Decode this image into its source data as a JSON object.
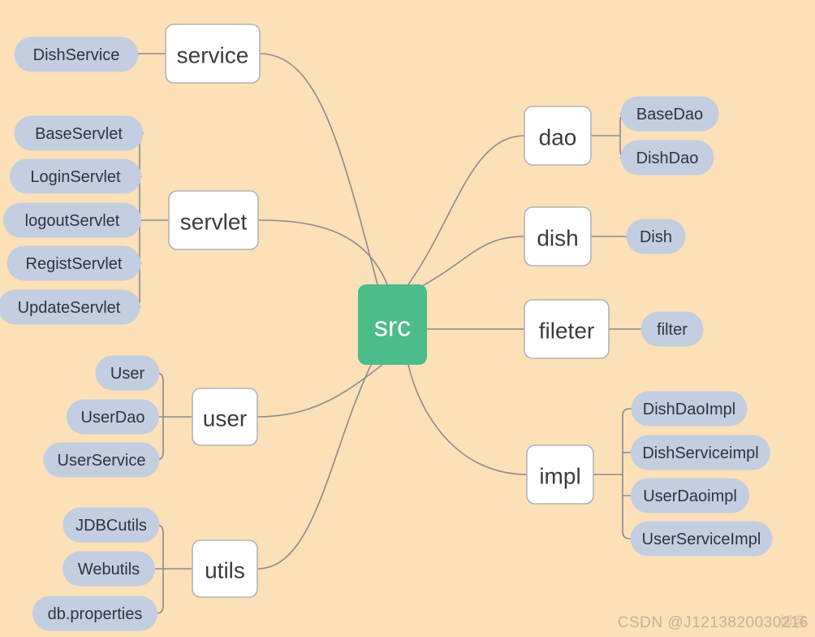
{
  "diagram": {
    "title": "src",
    "type": "mind-map",
    "background_color": "#fce0b8",
    "root": {
      "label": "src",
      "color": "#4cbc8b",
      "text_color": "#ffffff"
    },
    "branch_color": "#ffffff",
    "leaf_color": "#c3cee0",
    "link_color": "#8c8c8c",
    "branches": [
      {
        "label": "service",
        "side": "left",
        "leaves": [
          "DishService"
        ]
      },
      {
        "label": "servlet",
        "side": "left",
        "leaves": [
          "BaseServlet",
          "LoginServlet",
          "logoutServlet",
          "RegistServlet",
          "UpdateServlet"
        ]
      },
      {
        "label": "user",
        "side": "left",
        "leaves": [
          "User",
          "UserDao",
          "UserService"
        ]
      },
      {
        "label": "utils",
        "side": "left",
        "leaves": [
          "JDBCutils",
          "Webutils",
          "db.properties"
        ]
      },
      {
        "label": "dao",
        "side": "right",
        "leaves": [
          "BaseDao",
          "DishDao"
        ]
      },
      {
        "label": "dish",
        "side": "right",
        "leaves": [
          "Dish"
        ]
      },
      {
        "label": "fileter",
        "side": "right",
        "leaves": [
          "filter"
        ]
      },
      {
        "label": "impl",
        "side": "right",
        "leaves": [
          "DishDaoImpl",
          "DishServiceimpl",
          "UserDaoimpl",
          "UserServiceImpl"
        ]
      }
    ]
  },
  "watermark": {
    "text": "CSDN @J1213820030216",
    "sub_text": "博客"
  }
}
